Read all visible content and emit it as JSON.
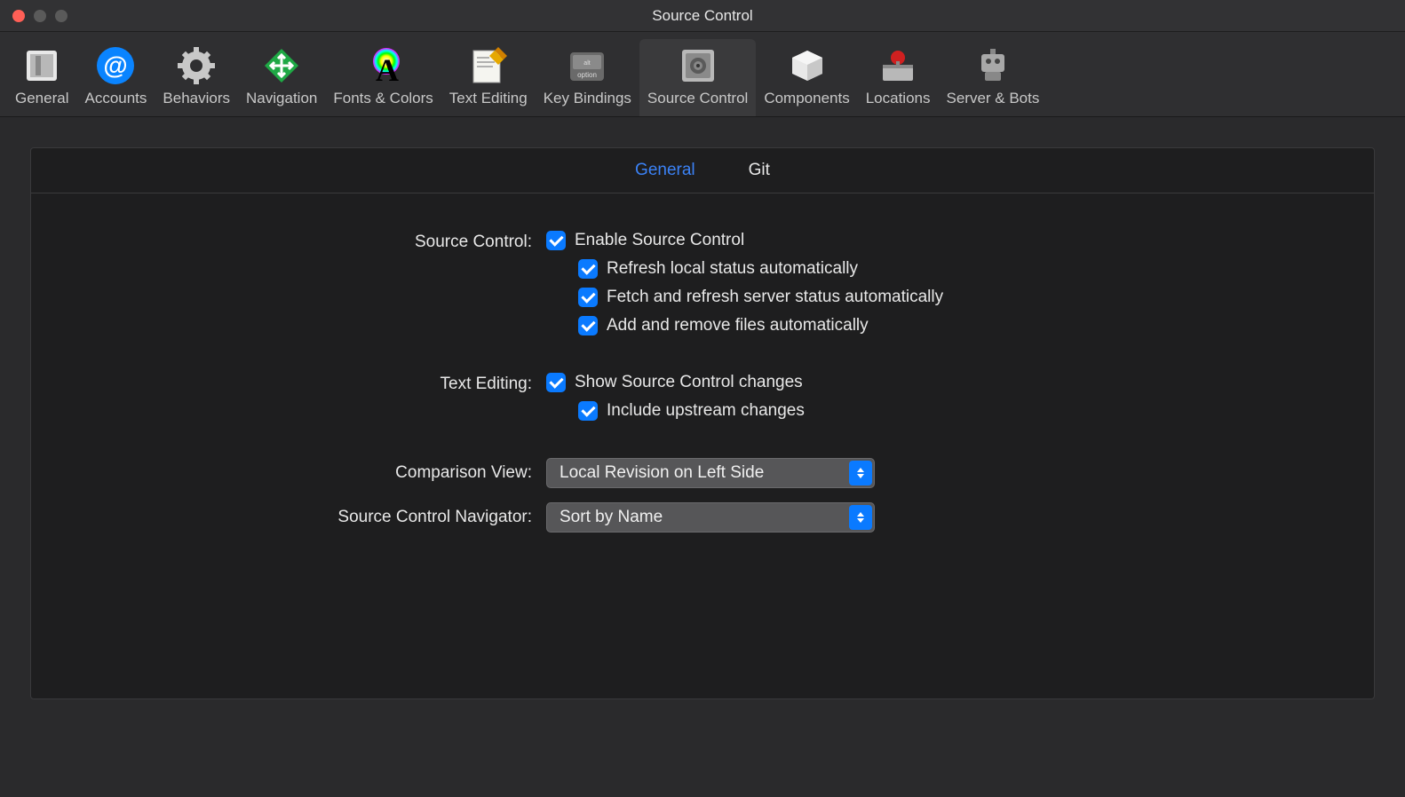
{
  "window": {
    "title": "Source Control"
  },
  "toolbar": {
    "items": [
      {
        "id": "general",
        "label": "General",
        "active": false
      },
      {
        "id": "accounts",
        "label": "Accounts",
        "active": false
      },
      {
        "id": "behaviors",
        "label": "Behaviors",
        "active": false
      },
      {
        "id": "navigation",
        "label": "Navigation",
        "active": false
      },
      {
        "id": "fonts-colors",
        "label": "Fonts & Colors",
        "active": false
      },
      {
        "id": "text-editing",
        "label": "Text Editing",
        "active": false
      },
      {
        "id": "key-bindings",
        "label": "Key Bindings",
        "active": false
      },
      {
        "id": "source-control",
        "label": "Source Control",
        "active": true
      },
      {
        "id": "components",
        "label": "Components",
        "active": false
      },
      {
        "id": "locations",
        "label": "Locations",
        "active": false
      },
      {
        "id": "server-bots",
        "label": "Server & Bots",
        "active": false
      }
    ]
  },
  "subtabs": {
    "general": "General",
    "git": "Git"
  },
  "sections": {
    "source_control": {
      "label": "Source Control:",
      "enable": "Enable Source Control",
      "refresh_local": "Refresh local status automatically",
      "fetch_server": "Fetch and refresh server status automatically",
      "add_remove": "Add and remove files automatically"
    },
    "text_editing": {
      "label": "Text Editing:",
      "show_changes": "Show Source Control changes",
      "include_upstream": "Include upstream changes"
    },
    "comparison_view": {
      "label": "Comparison View:",
      "value": "Local Revision on Left Side"
    },
    "navigator": {
      "label": "Source Control Navigator:",
      "value": "Sort by Name"
    }
  }
}
